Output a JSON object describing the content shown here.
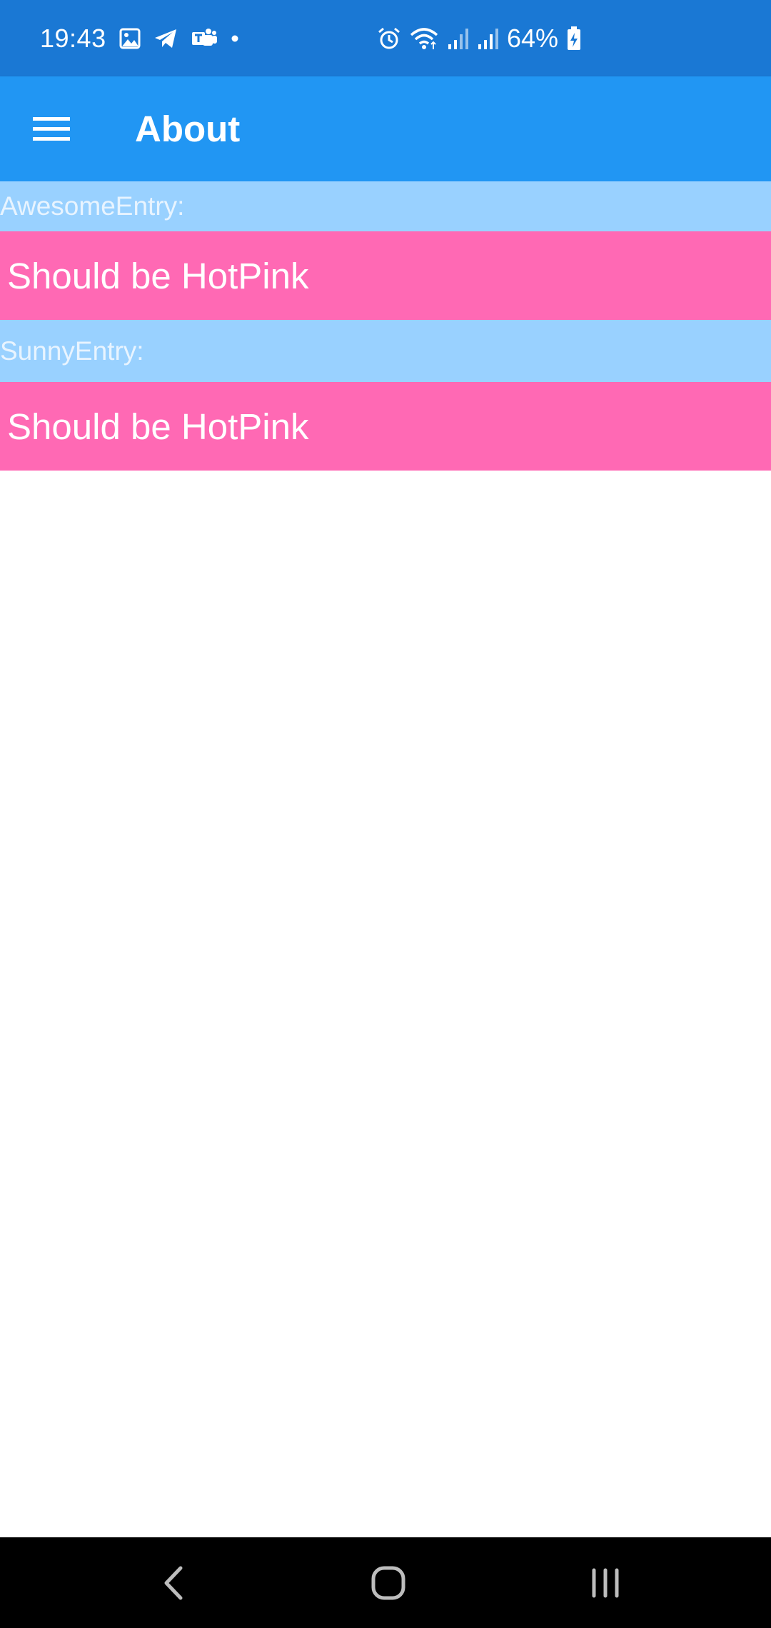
{
  "status_bar": {
    "time": "19:43",
    "battery": "64%",
    "left_icons": [
      "gallery-icon",
      "telegram-icon",
      "teams-icon",
      "notification-dot-icon"
    ],
    "right_icons": [
      "alarm-icon",
      "wifi-icon",
      "signal-icon",
      "signal-icon",
      "battery-charging-icon"
    ]
  },
  "app_bar": {
    "title": "About",
    "menu_icon": "hamburger-menu-icon"
  },
  "form": {
    "awesome_entry": {
      "label": "AwesomeEntry:",
      "value": "Should be HotPink"
    },
    "sunny_entry": {
      "label": "SunnyEntry:",
      "value": "Should be HotPink"
    }
  },
  "nav_bar": {
    "icons": [
      "back-icon",
      "home-icon",
      "recents-icon"
    ]
  },
  "colors": {
    "status_bar": "#1A78D4",
    "app_bar": "#2196F3",
    "label_background": "#99D1FF",
    "entry_background": "#FF69B4",
    "nav_bar": "#000000"
  }
}
